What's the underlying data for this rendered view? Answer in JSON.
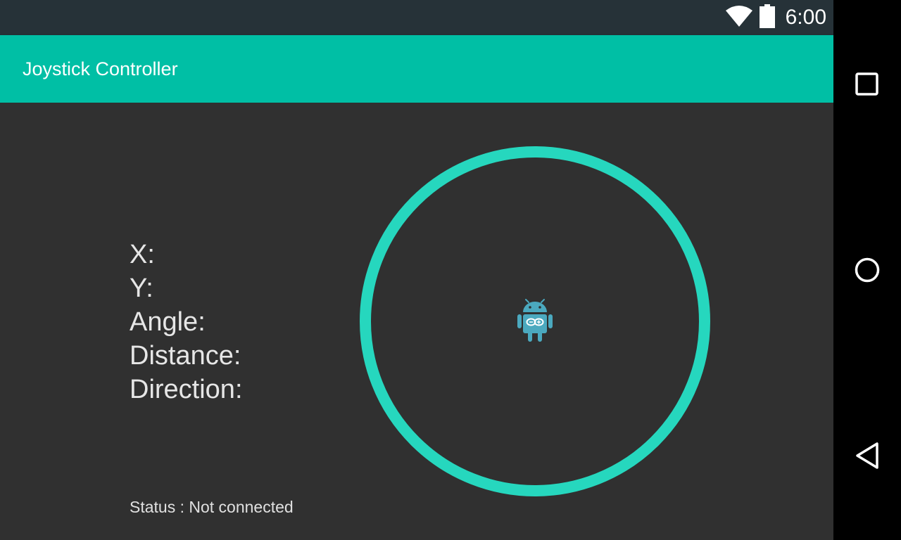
{
  "status_bar": {
    "time": "6:00",
    "icons": [
      "wifi-icon",
      "battery-icon"
    ]
  },
  "app_bar": {
    "title": "Joystick Controller"
  },
  "readouts": {
    "x_label": "X:",
    "x_value": "",
    "y_label": "Y:",
    "y_value": "",
    "angle_label": "Angle:",
    "angle_value": "",
    "distance_label": "Distance:",
    "distance_value": "",
    "direction_label": "Direction:",
    "direction_value": ""
  },
  "status": {
    "text": "Status : Not connected"
  },
  "joystick": {
    "ring_color": "#26D7BE",
    "knob_icon": "android-arduino-icon",
    "knob_color": "#4BA9BF"
  },
  "nav_bar": {
    "buttons": [
      "recents-icon",
      "home-icon",
      "back-icon"
    ]
  },
  "colors": {
    "status_bar": "#263238",
    "app_bar": "#00BFA5",
    "background": "#303030",
    "nav_bar": "#000000"
  }
}
